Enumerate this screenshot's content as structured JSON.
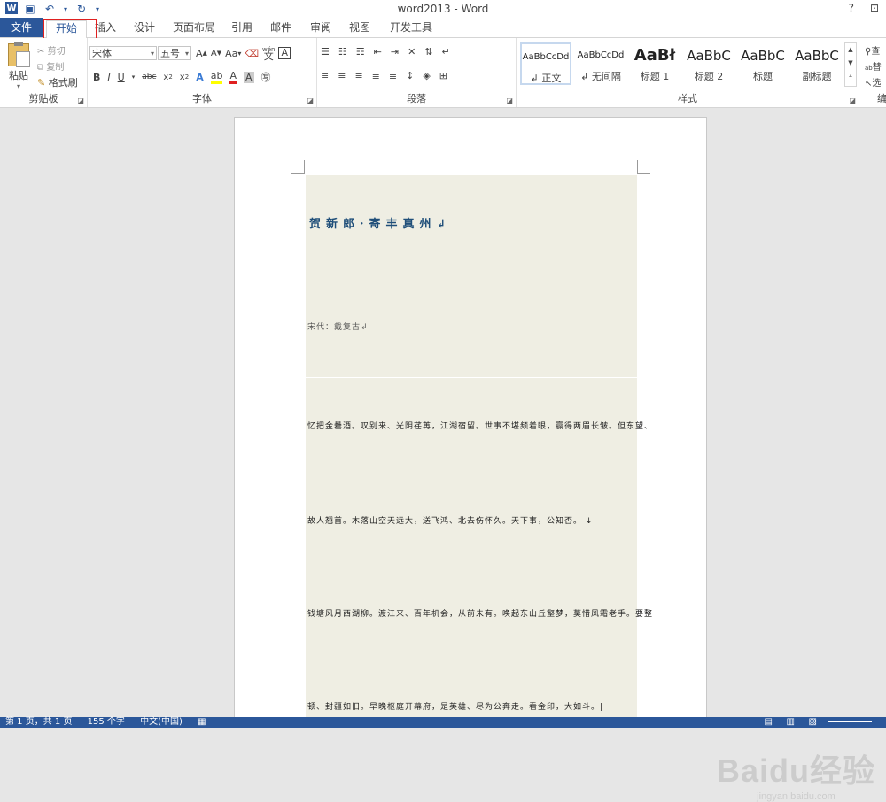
{
  "window": {
    "title": "word2013 - Word",
    "help_glyph": "?",
    "restore_glyph": "⊡"
  },
  "tabs": [
    "文件",
    "开始",
    "插入",
    "设计",
    "页面布局",
    "引用",
    "邮件",
    "审阅",
    "视图",
    "开发工具"
  ],
  "clipboard": {
    "label": "剪贴板",
    "paste": "粘贴",
    "cut": "剪切",
    "copy": "复制",
    "format_painter": "格式刷"
  },
  "font": {
    "label": "字体",
    "font_name": "宋体",
    "font_size": "五号",
    "aa": "Aa",
    "wen": "wén",
    "wen_char": "文",
    "a_box": "A"
  },
  "paragraph": {
    "label": "段落"
  },
  "styles": {
    "label": "样式",
    "items": [
      {
        "sample": "AaBbCcDd",
        "name": "↲ 正文"
      },
      {
        "sample": "AaBbCcDd",
        "name": "↲ 无间隔"
      },
      {
        "sample": "AaBł",
        "name": "标题 1"
      },
      {
        "sample": "AaBbC",
        "name": "标题 2"
      },
      {
        "sample": "AaBbC",
        "name": "标题"
      },
      {
        "sample": "AaBbC",
        "name": "副标题"
      }
    ]
  },
  "editing": {
    "label": "编",
    "find": "查",
    "replace": "替",
    "select": "选"
  },
  "document": {
    "title": "贺新郎·寄丰真州↲",
    "author": "宋代：戴复古↲",
    "lines": [
      "忆把金罍酒。叹别来、光阴荏苒，江湖宿留。世事不堪频着眼，赢得两眉长皱。但东望、",
      "故人翘首。木落山空天远大，送飞鸿、北去伤怀久。天下事，公知否。 ↓",
      "钱塘风月西湖柳。渡江来、百年机会，从前未有。唤起东山丘壑梦，莫惜风霜老手。要整",
      "顿、封疆如旧。早晚枢庭开幕府，是英雄、尽为公奔走。看金印，大如斗。|"
    ]
  },
  "status": {
    "page": "第 1 页，共 1 页",
    "words": "155 个字",
    "language": "中文(中国)"
  },
  "watermark": {
    "brand": "Baidu经验",
    "url": "jingyan.baidu.com"
  }
}
